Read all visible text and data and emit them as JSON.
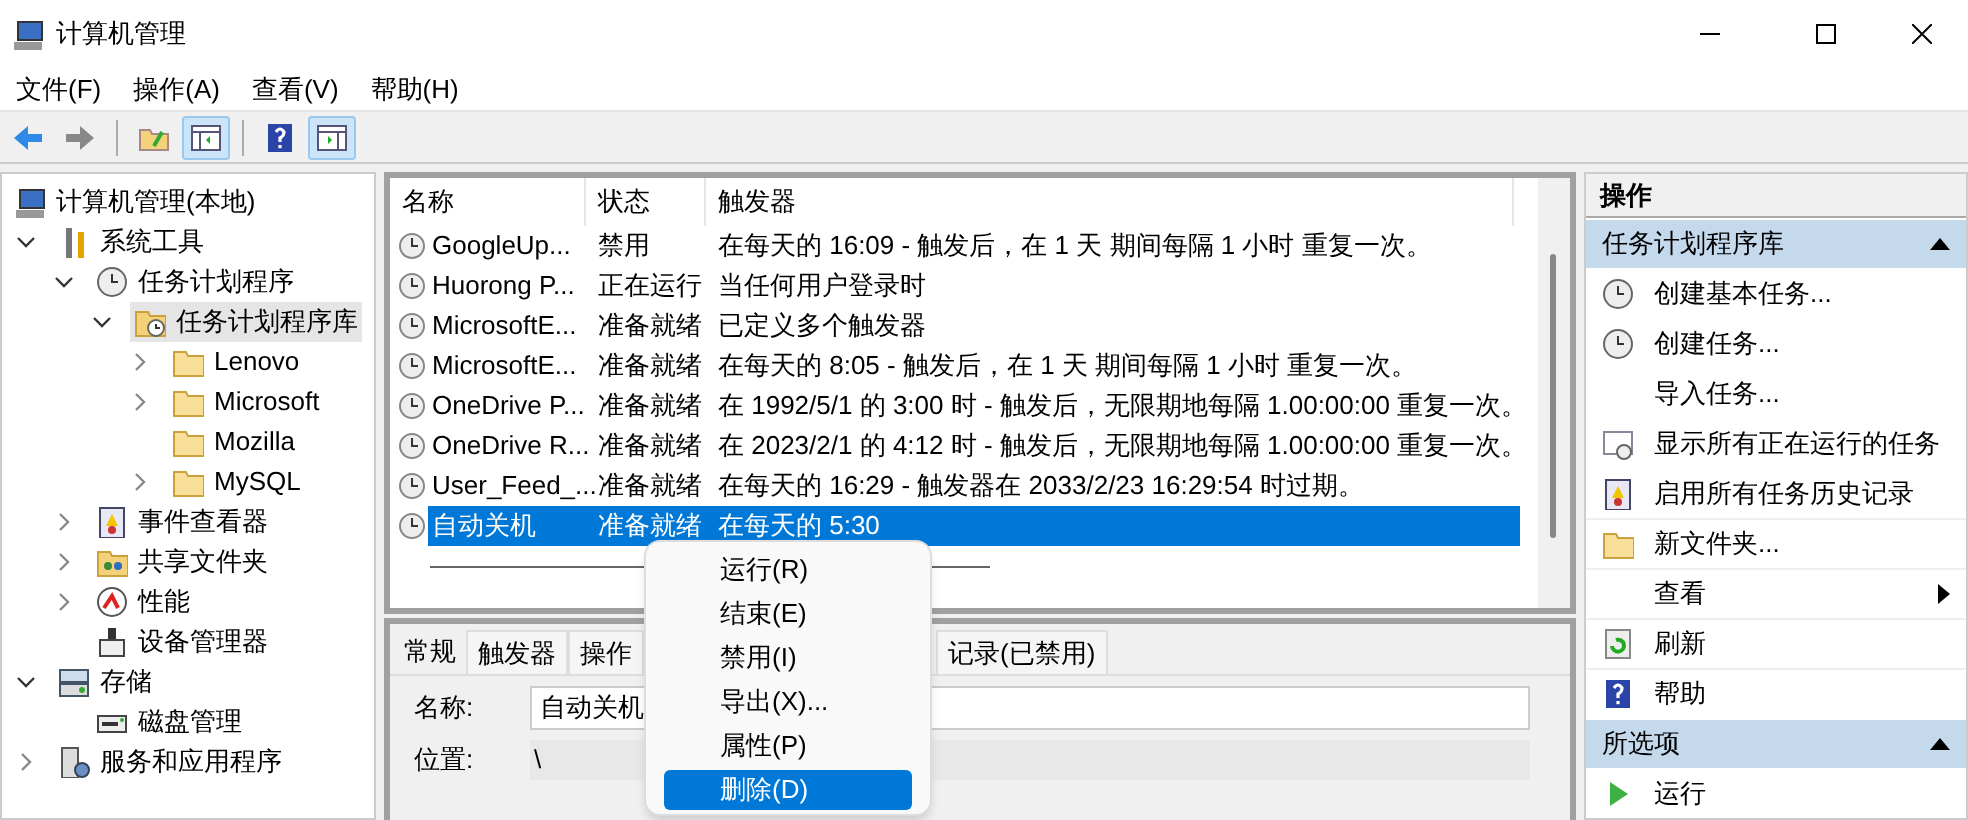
{
  "window": {
    "title": "计算机管理"
  },
  "menu_bar": [
    "文件(F)",
    "操作(A)",
    "查看(V)",
    "帮助(H)"
  ],
  "toolbar": [
    {
      "pressed": false
    },
    {
      "pressed": false
    },
    {
      "pressed": false
    },
    {
      "pressed": true
    },
    {
      "pressed": false
    },
    {
      "pressed": true
    }
  ],
  "tree": [
    {
      "label": "计算机管理(本地)",
      "selected": false,
      "children": [
        {
          "label": "系统工具",
          "selected": false,
          "expanded": true,
          "children": [
            {
              "label": "任务计划程序",
              "selected": false,
              "expanded": true,
              "children": [
                {
                  "label": "任务计划程序库",
                  "selected": true,
                  "expanded": true,
                  "children": [
                    {
                      "label": "Lenovo",
                      "selected": false,
                      "expanded": false
                    },
                    {
                      "label": "Microsoft",
                      "selected": false,
                      "expanded": false
                    },
                    {
                      "label": "Mozilla",
                      "selected": false
                    },
                    {
                      "label": "MySQL",
                      "selected": false,
                      "expanded": false
                    }
                  ]
                }
              ]
            },
            {
              "label": "事件查看器",
              "selected": false,
              "expanded": false
            },
            {
              "label": "共享文件夹",
              "selected": false,
              "expanded": false
            },
            {
              "label": "性能",
              "selected": false,
              "expanded": false
            },
            {
              "label": "设备管理器",
              "selected": false
            }
          ]
        },
        {
          "label": "存储",
          "selected": false,
          "expanded": true,
          "children": [
            {
              "label": "磁盘管理",
              "selected": false
            }
          ]
        },
        {
          "label": "服务和应用程序",
          "selected": false,
          "expanded": false
        }
      ]
    }
  ],
  "task_table": {
    "columns": [
      "名称",
      "状态",
      "触发器"
    ],
    "rows": [
      {
        "name": "GoogleUp...",
        "status": "禁用",
        "trigger": "在每天的 16:09 - 触发后，在 1 天 期间每隔 1 小时 重复一次。",
        "selected": false
      },
      {
        "name": "Huorong P...",
        "status": "正在运行",
        "trigger": "当任何用户登录时",
        "selected": false
      },
      {
        "name": "MicrosoftE...",
        "status": "准备就绪",
        "trigger": "已定义多个触发器",
        "selected": false
      },
      {
        "name": "MicrosoftE...",
        "status": "准备就绪",
        "trigger": "在每天的 8:05 - 触发后，在 1 天 期间每隔 1 小时 重复一次。",
        "selected": false
      },
      {
        "name": "OneDrive P...",
        "status": "准备就绪",
        "trigger": "在 1992/5/1 的 3:00 时 - 触发后，无限期地每隔 1.00:00:00 重复一次。",
        "selected": false
      },
      {
        "name": "OneDrive R...",
        "status": "准备就绪",
        "trigger": "在 2023/2/1 的 4:12 时 - 触发后，无限期地每隔 1.00:00:00 重复一次。",
        "selected": false
      },
      {
        "name": "User_Feed_...",
        "status": "准备就绪",
        "trigger": "在每天的 16:29 - 触发器在 2033/2/23 16:29:54 时过期。",
        "selected": false
      },
      {
        "name": "自动关机",
        "status": "准备就绪",
        "trigger": "在每天的 5:30",
        "selected": true
      }
    ]
  },
  "details": {
    "tabs": [
      {
        "label": "常规",
        "selected": true
      },
      {
        "label": "触发器",
        "selected": false
      },
      {
        "label": "操作",
        "selected": false
      },
      {
        "label": "记录(已禁用)",
        "selected": false
      }
    ],
    "fields": [
      {
        "label": "名称:",
        "value": "自动关机",
        "kind": "input"
      },
      {
        "label": "位置:",
        "value": "\\",
        "kind": "text"
      }
    ]
  },
  "context_menu": [
    {
      "label": "运行(R)",
      "selected": false
    },
    {
      "label": "结束(E)",
      "selected": false
    },
    {
      "label": "禁用(I)",
      "selected": false
    },
    {
      "label": "导出(X)...",
      "selected": false
    },
    {
      "label": "属性(P)",
      "selected": false
    },
    {
      "label": "删除(D)",
      "selected": true
    }
  ],
  "actions_pane": {
    "title": "操作",
    "sections": [
      {
        "title": "任务计划程序库",
        "items": [
          {
            "label": "创建基本任务..."
          },
          {
            "label": "创建任务..."
          },
          {
            "label": "导入任务..."
          },
          {
            "label": "显示所有正在运行的任务"
          },
          {
            "label": "启用所有任务历史记录"
          },
          {
            "label": "新文件夹..."
          },
          {
            "label": "查看",
            "submenu": true
          },
          {
            "label": "刷新"
          },
          {
            "label": "帮助"
          }
        ]
      },
      {
        "title": "所选项",
        "items": [
          {
            "label": "运行"
          }
        ]
      }
    ]
  }
}
